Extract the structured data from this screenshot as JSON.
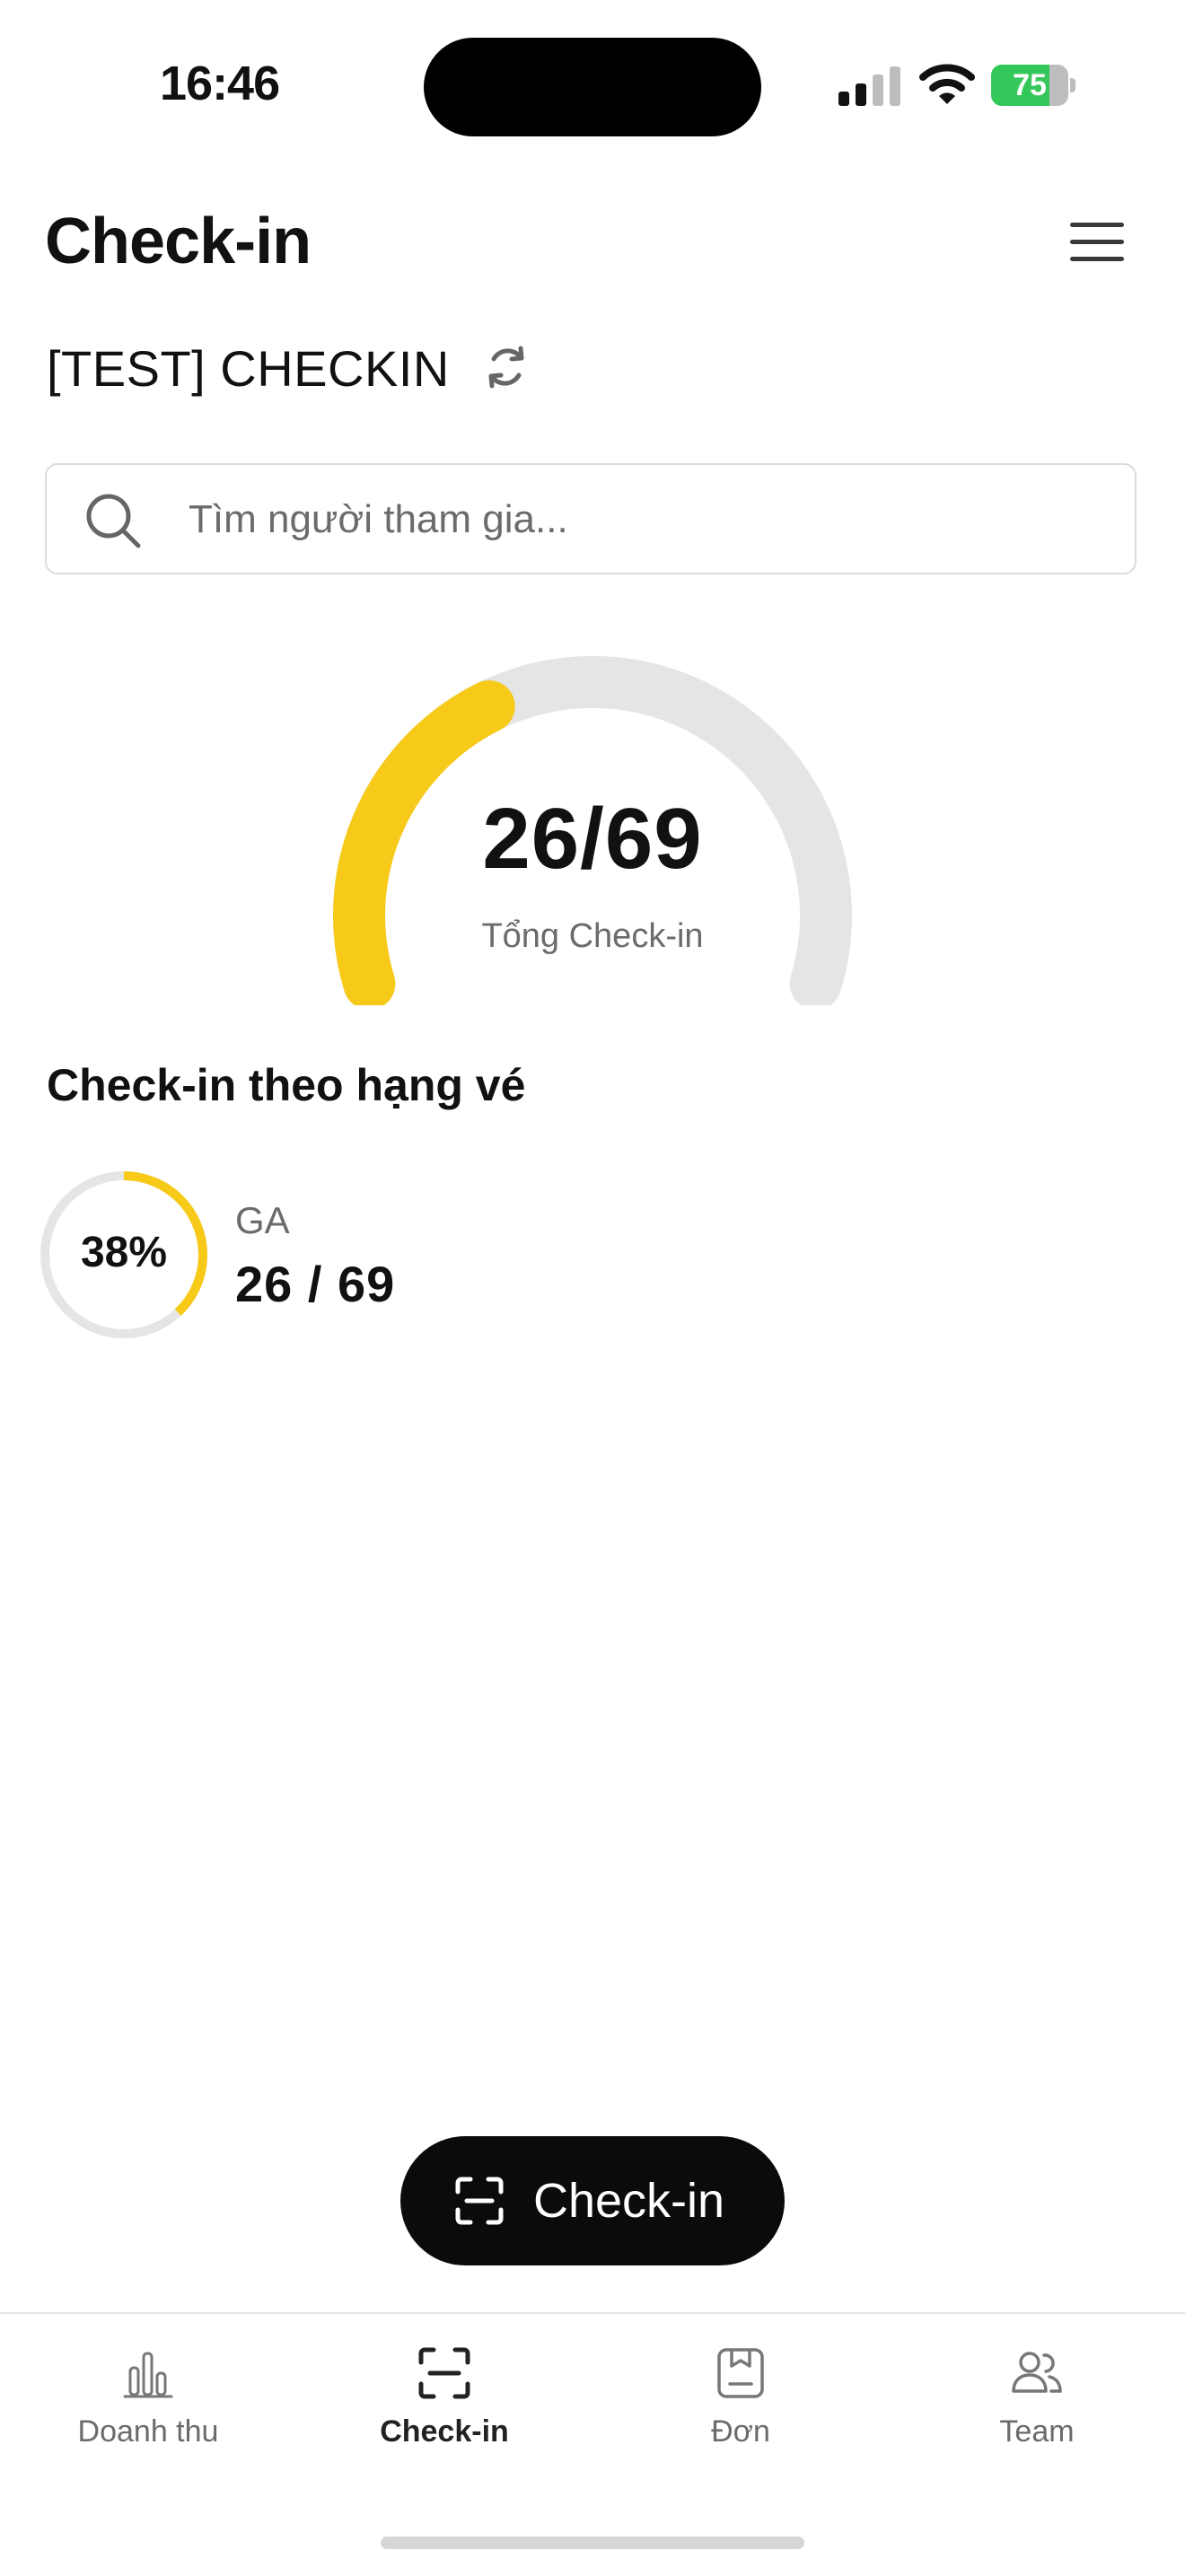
{
  "status_bar": {
    "time": "16:46",
    "battery": "75"
  },
  "header": {
    "title": "Check-in"
  },
  "event": {
    "name": "[TEST] CHECKIN"
  },
  "search": {
    "placeholder": "Tìm người tham gia..."
  },
  "summary": {
    "checked_in": 26,
    "total": 69,
    "value_text": "26/69",
    "label": "Tổng Check-in",
    "progress_fraction": 0.377
  },
  "tiers": {
    "title": "Check-in theo hạng vé",
    "items": [
      {
        "name": "GA",
        "percent_text": "38%",
        "percent": 38,
        "count_text": "26 / 69"
      }
    ]
  },
  "fab": {
    "label": "Check-in"
  },
  "tabs": [
    {
      "label": "Doanh thu",
      "icon": "bar-chart-icon",
      "active": false
    },
    {
      "label": "Check-in",
      "icon": "scan-icon",
      "active": true
    },
    {
      "label": "Đơn",
      "icon": "order-icon",
      "active": false
    },
    {
      "label": "Team",
      "icon": "users-icon",
      "active": false
    }
  ],
  "colors": {
    "accent": "#F7C918",
    "track": "#E5E5E5",
    "fab_bg": "#0B0B0B",
    "battery": "#34C759"
  }
}
